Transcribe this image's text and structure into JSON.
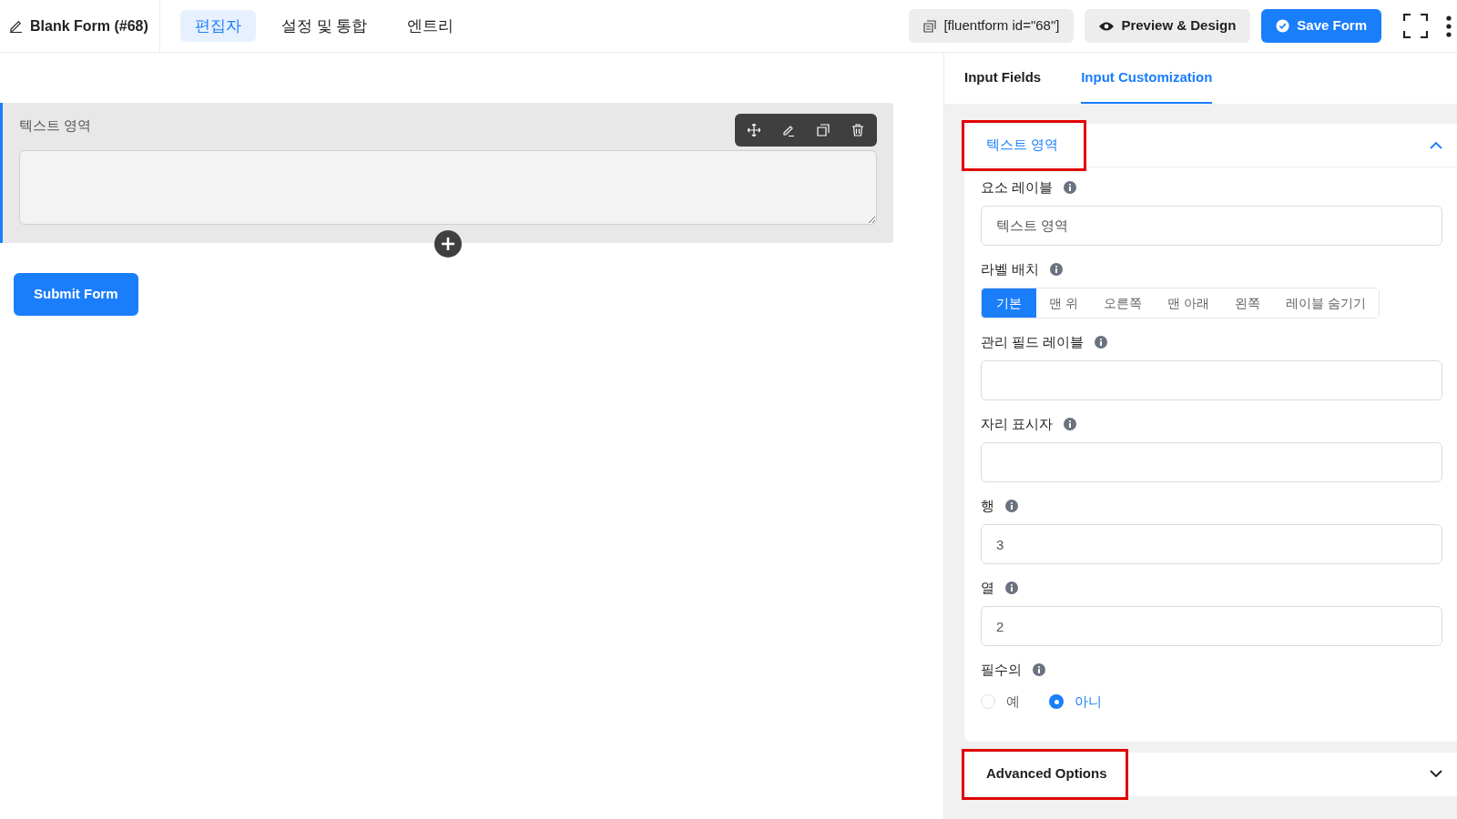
{
  "header": {
    "title": "Blank Form (#68)",
    "shortcode": "[fluentform id=\"68\"]",
    "preview_button": "Preview & Design",
    "save_button": "Save Form",
    "tabs": [
      {
        "label": "편집자",
        "selected": true
      },
      {
        "label": "설정 및 통합",
        "selected": false
      },
      {
        "label": "엔트리",
        "selected": false
      }
    ]
  },
  "canvas": {
    "field": {
      "label": "텍스트 영역",
      "selected": true
    },
    "submit_button": "Submit Form"
  },
  "panel": {
    "tabs": [
      {
        "label": "Input Fields",
        "selected": false
      },
      {
        "label": "Input Customization",
        "selected": true
      }
    ],
    "sections": [
      {
        "title": "텍스트 영역",
        "expanded": true,
        "highlighted": true,
        "settings": [
          {
            "kind": "text",
            "label": "요소 레이블",
            "value": "텍스트 영역"
          },
          {
            "kind": "segmented",
            "label": "라벨 배치",
            "options": [
              {
                "label": "기본",
                "selected": true
              },
              {
                "label": "맨 위",
                "selected": false
              },
              {
                "label": "오른쪽",
                "selected": false
              },
              {
                "label": "맨 아래",
                "selected": false
              },
              {
                "label": "왼쪽",
                "selected": false
              },
              {
                "label": "레이블 숨기기",
                "selected": false
              }
            ]
          },
          {
            "kind": "text",
            "label": "관리 필드 레이블"
          },
          {
            "kind": "text",
            "label": "자리 표시자"
          },
          {
            "kind": "text",
            "label": "행",
            "value": "3"
          },
          {
            "kind": "text",
            "label": "열",
            "value": "2"
          },
          {
            "kind": "radio",
            "label": "필수의",
            "options": [
              {
                "label": "예",
                "selected": false
              },
              {
                "label": "아니",
                "selected": true
              }
            ]
          }
        ]
      },
      {
        "title": "Advanced Options",
        "expanded": false,
        "highlighted": true
      }
    ]
  }
}
